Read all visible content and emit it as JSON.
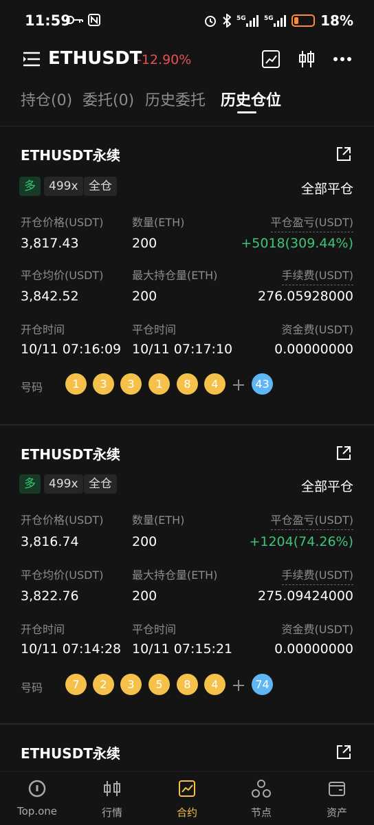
{
  "status_bar": {
    "time": "11:59",
    "battery": "18%"
  },
  "header": {
    "symbol": "ETHUSDT",
    "change": "-12.90%"
  },
  "tabs": [
    {
      "label": "持仓(0)"
    },
    {
      "label": "委托(0)"
    },
    {
      "label": "历史委托"
    },
    {
      "label": "历史仓位"
    }
  ],
  "cards": [
    {
      "title": "ETHUSDT永续",
      "side": "多",
      "leverage": "499x",
      "margin_mode": "全仓",
      "close_all": "全部平仓",
      "labels": {
        "open_price": "开仓价格(USDT)",
        "qty": "数量(ETH)",
        "pnl": "平仓盈亏(USDT)",
        "avg_close": "平仓均价(USDT)",
        "max_pos": "最大持仓量(ETH)",
        "fee": "手续费(USDT)",
        "open_time": "开仓时间",
        "close_time": "平仓时间",
        "funding": "资金费(USDT)",
        "numbers": "号码"
      },
      "open_price": "3,817.43",
      "qty": "200",
      "pnl": "+5018(309.44%)",
      "avg_close": "3,842.52",
      "max_pos": "200",
      "fee": "276.05928000",
      "open_time": "10/11 07:16:09",
      "close_time": "10/11 07:17:10",
      "funding": "0.00000000",
      "balls": [
        "1",
        "3",
        "3",
        "1",
        "8",
        "4"
      ],
      "bonus": "43"
    },
    {
      "title": "ETHUSDT永续",
      "side": "多",
      "leverage": "499x",
      "margin_mode": "全仓",
      "close_all": "全部平仓",
      "labels": {
        "open_price": "开仓价格(USDT)",
        "qty": "数量(ETH)",
        "pnl": "平仓盈亏(USDT)",
        "avg_close": "平仓均价(USDT)",
        "max_pos": "最大持仓量(ETH)",
        "fee": "手续费(USDT)",
        "open_time": "开仓时间",
        "close_time": "平仓时间",
        "funding": "资金费(USDT)",
        "numbers": "号码"
      },
      "open_price": "3,816.74",
      "qty": "200",
      "pnl": "+1204(74.26%)",
      "avg_close": "3,822.76",
      "max_pos": "200",
      "fee": "275.09424000",
      "open_time": "10/11 07:14:28",
      "close_time": "10/11 07:15:21",
      "funding": "0.00000000",
      "balls": [
        "7",
        "2",
        "3",
        "5",
        "8",
        "4"
      ],
      "bonus": "74"
    },
    {
      "title": "ETHUSDT永续"
    }
  ],
  "bottom_nav": [
    {
      "label": "Top.one",
      "icon": "top-one-icon"
    },
    {
      "label": "行情",
      "icon": "candlestick-icon"
    },
    {
      "label": "合约",
      "icon": "chart-icon"
    },
    {
      "label": "节点",
      "icon": "node-icon"
    },
    {
      "label": "资产",
      "icon": "wallet-icon"
    }
  ],
  "colors": {
    "accent": "#f5c14a",
    "profit": "#3dc57a",
    "loss": "#e5524f",
    "ball_blue": "#5eb6f5"
  }
}
